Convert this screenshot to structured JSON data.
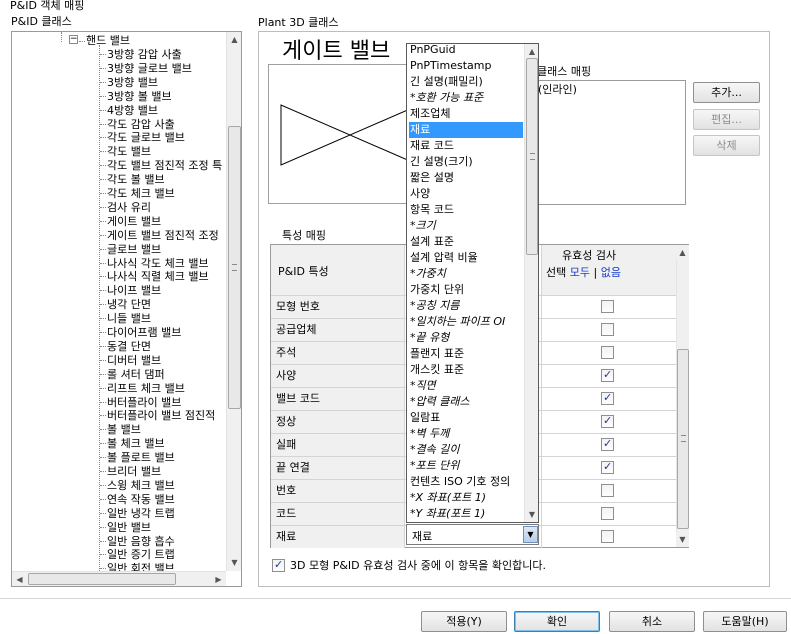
{
  "window_title": "P&ID 객체 매핑",
  "left_panel": {
    "title": "P&ID 클래스",
    "tree_parent": "핸드 밸브",
    "tree_items": [
      "3방향 감압 사출",
      "3방향 글로브 밸브",
      "3방향 밸브",
      "3방향 볼 밸브",
      "4방향 밸브",
      "각도 감압 사출",
      "각도 글로브 밸브",
      "각도 밸브",
      "각도 밸브 점진적 조정 특",
      "각도 볼 밸브",
      "각도 체크 밸브",
      "검사 유리",
      "게이트 밸브",
      "게이트 밸브 점진적 조정",
      "글로브 밸브",
      "나사식 각도 체크 밸브",
      "나사식 직렬 체크 밸브",
      "나이프 밸브",
      "냉각 단면",
      "니들 밸브",
      "다이어프램 밸브",
      "동결 단면",
      "디버터 밸브",
      "롤 셔터 댐퍼",
      "리프트 체크 밸브",
      "버터플라이 밸브",
      "버터플라이 밸브 점진적",
      "볼 밸브",
      "볼 체크 밸브",
      "볼 플로트 밸브",
      "브리더 밸브",
      "스윙 체크 밸브",
      "연속 작동 밸브",
      "일반 냉각 트랩",
      "일반 밸브",
      "일반 음향 흡수",
      "일반 증기 트랩",
      "일반 회전 밸브"
    ]
  },
  "right_panel": {
    "title": "Plant 3D 클래스",
    "class_name": "게이트 밸브",
    "class_mapping_label": "클래스 매핑",
    "class_mapping_value": "(인라인)",
    "buttons": {
      "add": "추가...",
      "edit": "편집...",
      "delete": "삭제"
    },
    "property_mapping_label": "특성 매핑",
    "grid": {
      "col1": "P&ID 특성",
      "col3_title": "유효성 검사",
      "col3_select": "선택",
      "col3_all": "모두",
      "col3_sep": "|",
      "col3_none": "없음",
      "rows": [
        {
          "name": "모형 번호",
          "value": "",
          "checked": false
        },
        {
          "name": "공급업체",
          "value": "",
          "checked": false
        },
        {
          "name": "주석",
          "value": "",
          "checked": false
        },
        {
          "name": "사양",
          "value": "",
          "checked": true
        },
        {
          "name": "밸브 코드",
          "value": "",
          "checked": true
        },
        {
          "name": "정상",
          "value": "",
          "checked": true
        },
        {
          "name": "실패",
          "value": "",
          "checked": true
        },
        {
          "name": "끝 연결",
          "value": "",
          "checked": true
        },
        {
          "name": "번호",
          "value": "",
          "checked": false
        },
        {
          "name": "코드",
          "value": "",
          "checked": false
        },
        {
          "name": "재료",
          "value": "재료",
          "checked": false
        }
      ]
    },
    "dropdown": {
      "selected": "재료",
      "items": [
        {
          "label": "PnPGuid",
          "italic": false
        },
        {
          "label": "PnPTimestamp",
          "italic": false
        },
        {
          "label": "긴 설명(패밀리)",
          "italic": false
        },
        {
          "label": "*호환 가능 표준",
          "italic": true
        },
        {
          "label": "제조업체",
          "italic": false
        },
        {
          "label": "재료",
          "italic": false
        },
        {
          "label": "재료 코드",
          "italic": false
        },
        {
          "label": "긴 설명(크기)",
          "italic": false
        },
        {
          "label": "짧은 설명",
          "italic": false
        },
        {
          "label": "사양",
          "italic": false
        },
        {
          "label": "항목 코드",
          "italic": false
        },
        {
          "label": "*크기",
          "italic": true
        },
        {
          "label": "설계 표준",
          "italic": false
        },
        {
          "label": "설계 압력 비율",
          "italic": false
        },
        {
          "label": "*가중치",
          "italic": true
        },
        {
          "label": "가중치 단위",
          "italic": false
        },
        {
          "label": "*공칭 지름",
          "italic": true
        },
        {
          "label": "*일치하는 파이프 OI",
          "italic": true
        },
        {
          "label": "*끝 유형",
          "italic": true
        },
        {
          "label": "플랜지 표준",
          "italic": false
        },
        {
          "label": "개스킷 표준",
          "italic": false
        },
        {
          "label": "*직면",
          "italic": true
        },
        {
          "label": "*압력 클래스",
          "italic": true
        },
        {
          "label": "일람표",
          "italic": false
        },
        {
          "label": "*벽 두께",
          "italic": true
        },
        {
          "label": "*결속 길이",
          "italic": true
        },
        {
          "label": "*포트 단위",
          "italic": true
        },
        {
          "label": "컨텐츠 ISO 기호 정의",
          "italic": false
        },
        {
          "label": "*X 좌표(포트 1)",
          "italic": true
        },
        {
          "label": "*Y 좌표(포트 1)",
          "italic": true
        }
      ]
    },
    "validate_checkbox": {
      "label": "3D 모형 P&ID 유효성 검사 중에 이 항목을 확인합니다.",
      "checked": true
    }
  },
  "footer": {
    "apply": "적용(Y)",
    "ok": "확인",
    "cancel": "취소",
    "help": "도움말(H)"
  }
}
